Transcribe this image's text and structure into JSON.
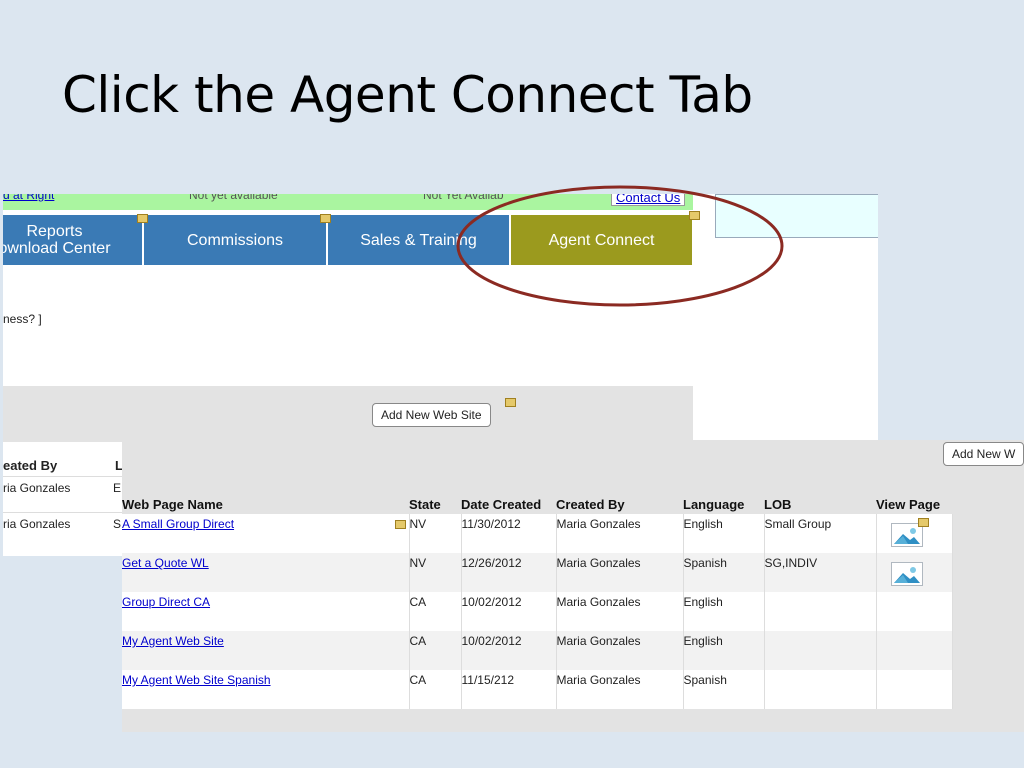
{
  "slide": {
    "title": "Click the Agent Connect Tab"
  },
  "back": {
    "strip": {
      "left_link": "d at Right",
      "mid1": "Not yet available",
      "mid2": "Not Yet Availab",
      "contact": "Contact Us"
    },
    "nav": {
      "reports_line1": "Reports",
      "reports_line2": "ownload Center",
      "commissions": "Commissions",
      "sales": "Sales & Training",
      "agent": "Agent Connect"
    },
    "business_text": "ness? ]",
    "add_button": "Add New Web Site",
    "table": {
      "header_created_by": "eated By",
      "header_l": "L",
      "rows": [
        {
          "created_by": "ria Gonzales",
          "l": "E"
        },
        {
          "created_by": "ria Gonzales",
          "l": "S"
        }
      ]
    }
  },
  "front": {
    "add_button": "Add New W",
    "headers": {
      "name": "Web Page Name",
      "state": "State",
      "date": "Date Created",
      "created_by": "Created By",
      "language": "Language",
      "lob": "LOB",
      "view": "View Page"
    },
    "rows": [
      {
        "name": "A Small Group Direct",
        "state": "NV",
        "date": "11/30/2012",
        "created_by": "Maria Gonzales",
        "language": "English",
        "lob": "Small Group",
        "view_icon": "image-icon"
      },
      {
        "name": "Get a Quote WL",
        "state": "NV",
        "date": "12/26/2012",
        "created_by": "Maria Gonzales",
        "language": "Spanish",
        "lob": "SG,INDIV",
        "view_icon": "image-icon"
      },
      {
        "name": "Group Direct CA",
        "state": "CA",
        "date": "10/02/2012",
        "created_by": "Maria Gonzales",
        "language": "English",
        "lob": "",
        "view_icon": ""
      },
      {
        "name": "My Agent Web Site",
        "state": "CA",
        "date": "10/02/2012",
        "created_by": "Maria Gonzales",
        "language": "English",
        "lob": "",
        "view_icon": ""
      },
      {
        "name": "My Agent Web Site Spanish",
        "state": "CA",
        "date": "11/15/212",
        "created_by": "Maria Gonzales",
        "language": "Spanish",
        "lob": "",
        "view_icon": ""
      }
    ]
  },
  "colors": {
    "nav_blue": "#3a7ab5",
    "active_tab": "#9b9a1e",
    "annotation": "#8b2a22",
    "link": "#0000cc"
  }
}
